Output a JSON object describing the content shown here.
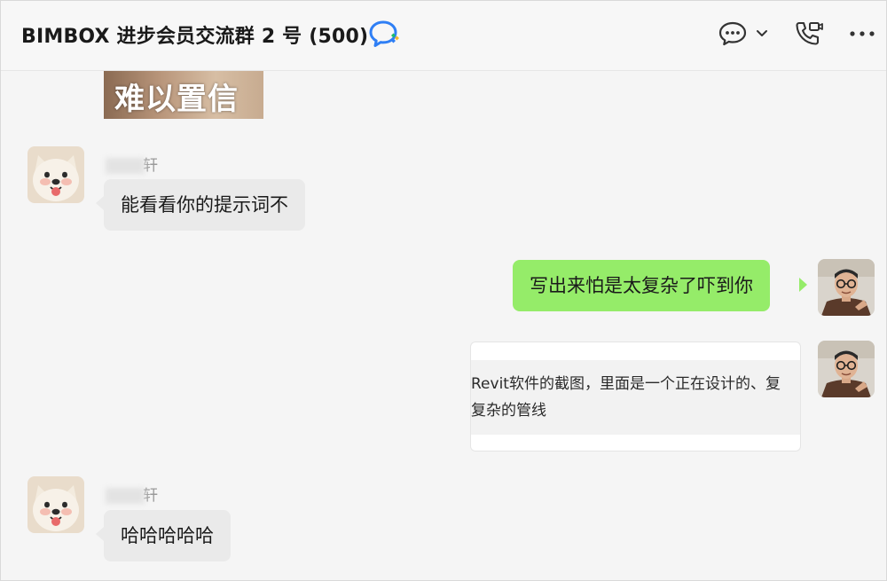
{
  "header": {
    "title": "BIMBOX 进步会员交流群 2 号 (500)",
    "icons": [
      "group-chat-badge-icon",
      "chat-bubble-icon",
      "chevron-down-icon",
      "video-call-icon",
      "more-icon"
    ]
  },
  "messages": {
    "sticker": {
      "text": "难以置信"
    },
    "msg1": {
      "nickname_tail": "轩",
      "text": "能看看你的提示词不"
    },
    "msg2": {
      "text": "写出来怕是太复杂了吓到你"
    },
    "msg3": {
      "line1": "Revit软件的截图，里面是一个正在设计的、复",
      "line2": "复杂的管线"
    },
    "msg4": {
      "nickname_tail": "轩",
      "text": "哈哈哈哈哈"
    }
  },
  "colors": {
    "incoming_bubble": "#eaeaea",
    "outgoing_bubble": "#95ec69",
    "chat_background": "#f5f5f5",
    "badge_blue": "#2f7ff5",
    "badge_green": "#1fbd67",
    "badge_yellow": "#f5b82e"
  }
}
